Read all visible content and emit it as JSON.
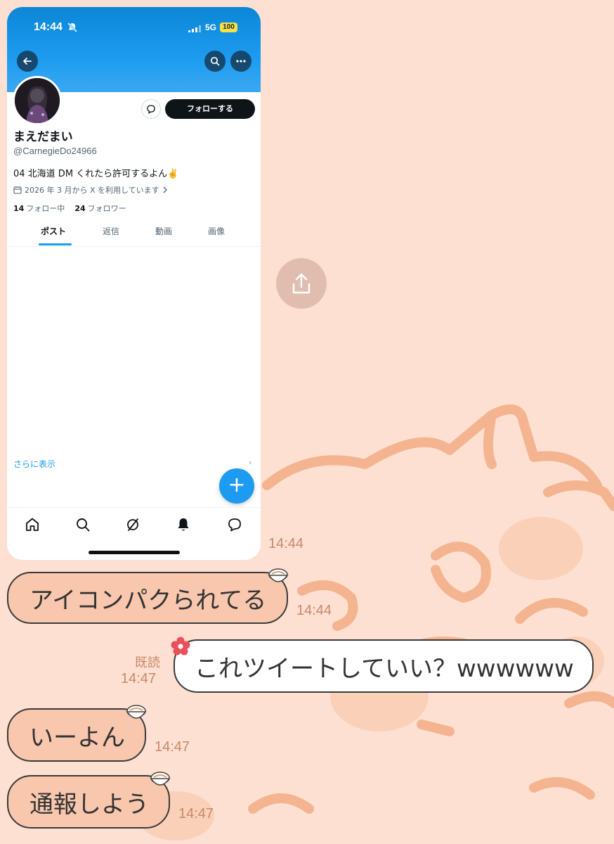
{
  "wallpaper": {
    "bg_color": "#fde0d2",
    "motif_color": "#f4b48f"
  },
  "shared_screenshot": {
    "status_bar": {
      "time": "14:44",
      "network": "5G",
      "battery": "100"
    },
    "header_icons": [
      "back-arrow-icon",
      "search-icon",
      "more-icon"
    ],
    "profile": {
      "display_name": "まえだまい",
      "handle": "@CarnegieDo24966",
      "bio": "04 北海道 DM くれたら許可するよん✌️",
      "joined": "2026 年 3 月から X を利用しています",
      "following_count": "14",
      "following_label": "フォロー中",
      "followers_count": "24",
      "followers_label": "フォロワー",
      "follow_button_label": "フォローする"
    },
    "tabs": [
      {
        "label": "ポスト",
        "active": true
      },
      {
        "label": "返信",
        "active": false
      },
      {
        "label": "動画",
        "active": false
      },
      {
        "label": "画像",
        "active": false
      }
    ],
    "show_more_label": "さらに表示",
    "fab_label": "+",
    "bottom_nav": [
      "home-icon",
      "search-icon",
      "grok-icon",
      "notifications-icon",
      "messages-icon"
    ],
    "accent_color": "#1d9bf0"
  },
  "chat": {
    "image_timestamp": "14:44",
    "messages": [
      {
        "side": "incoming",
        "text": "アイコンパクられてる",
        "time": "14:44"
      },
      {
        "side": "outgoing",
        "text": "これツイートしていい？wwwwww",
        "read_label": "既読",
        "time": "14:47"
      },
      {
        "side": "incoming",
        "text": "いーよん",
        "time": "14:47"
      },
      {
        "side": "incoming",
        "text": "通報しよう",
        "time": "14:47"
      }
    ],
    "incoming_bubble_color": "#f8c7ad",
    "outgoing_bubble_color": "#ffffff"
  }
}
